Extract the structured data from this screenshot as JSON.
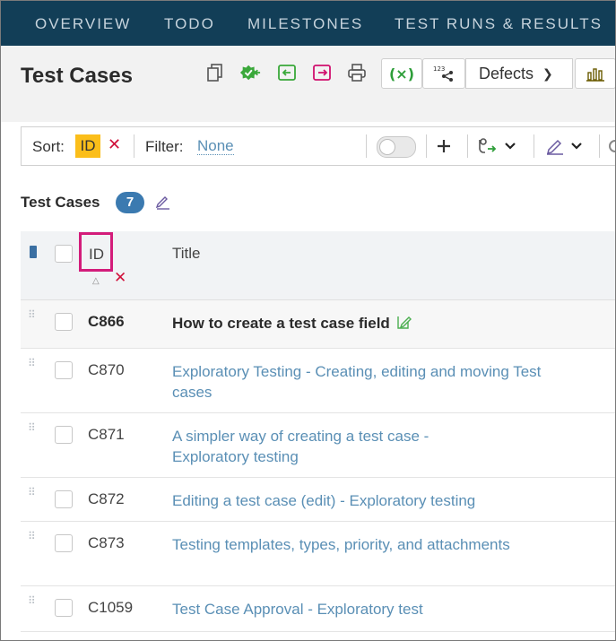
{
  "nav": {
    "tabs": [
      "OVERVIEW",
      "TODO",
      "MILESTONES",
      "TEST RUNS & RESULTS"
    ]
  },
  "header": {
    "title": "Test Cases",
    "toolbar_icons": [
      "copy-icon",
      "add-results-icon",
      "import-icon",
      "export-icon",
      "print-icon",
      "variables-icon",
      "numbered-list-icon"
    ],
    "defects_label": "Defects"
  },
  "sortbar": {
    "sort_label": "Sort:",
    "sort_value": "ID",
    "filter_label": "Filter:",
    "filter_value": "None"
  },
  "section": {
    "title": "Test Cases",
    "count": "7"
  },
  "table": {
    "columns": {
      "id": "ID",
      "title": "Title"
    },
    "rows": [
      {
        "id": "C866",
        "title": "How to create a test case field"
      },
      {
        "id": "C870",
        "title": "Exploratory Testing - Creating, editing and moving Test cases"
      },
      {
        "id": "C871",
        "title": "A simpler way of creating a test case - Exploratory testing"
      },
      {
        "id": "C872",
        "title": "Editing a test case (edit) - Exploratory testing"
      },
      {
        "id": "C873",
        "title": "Testing templates, types, priority, and attachments"
      },
      {
        "id": "C1059",
        "title": "Test Case Approval - Exploratory test"
      }
    ]
  },
  "colors": {
    "nav_bg": "#123e57",
    "sort_chip": "#fbbe1a",
    "link": "#5a8fb5",
    "count_badge": "#3b7ab0",
    "highlight_border": "#d31c7a",
    "remove": "#d0103a"
  }
}
